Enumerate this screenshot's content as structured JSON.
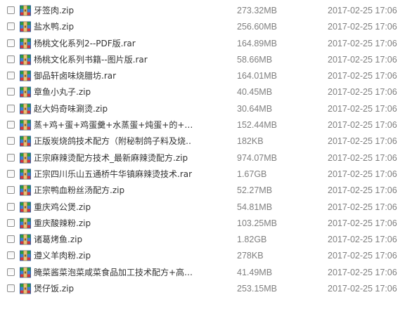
{
  "icon_name": "archive-icon",
  "files": [
    {
      "name": "牙签肉.zip",
      "size": "273.32MB",
      "date": "2017-02-25 17:06"
    },
    {
      "name": "盐水鸭.zip",
      "size": "256.60MB",
      "date": "2017-02-25 17:06"
    },
    {
      "name": "杨桃文化系列2--PDF版.rar",
      "size": "164.89MB",
      "date": "2017-02-25 17:06"
    },
    {
      "name": "杨桃文化系列书籍--图片版.rar",
      "size": "58.66MB",
      "date": "2017-02-25 17:06"
    },
    {
      "name": "御品轩卤味烧腊坊.rar",
      "size": "164.01MB",
      "date": "2017-02-25 17:06"
    },
    {
      "name": "章鱼小丸子.zip",
      "size": "40.45MB",
      "date": "2017-02-25 17:06"
    },
    {
      "name": "赵大妈奇味涮烫.zip",
      "size": "30.64MB",
      "date": "2017-02-25 17:06"
    },
    {
      "name": "蒸+鸡+蛋+鸡蛋羹+水蒸蛋+炖蛋+的+…",
      "size": "152.44MB",
      "date": "2017-02-25 17:06"
    },
    {
      "name": "正版炭烧鸽技术配方（附秘制鸽子料及烧…",
      "size": "182KB",
      "date": "2017-02-25 17:06"
    },
    {
      "name": "正宗麻辣烫配方技术_最新麻辣烫配方.zip",
      "size": "974.07MB",
      "date": "2017-02-25 17:06"
    },
    {
      "name": "正宗四川乐山五通桥牛华镇麻辣烫技术.rar",
      "size": "1.67GB",
      "date": "2017-02-25 17:06"
    },
    {
      "name": "正宗鸭血粉丝汤配方.zip",
      "size": "52.27MB",
      "date": "2017-02-25 17:06"
    },
    {
      "name": "重庆鸡公煲.zip",
      "size": "54.81MB",
      "date": "2017-02-25 17:06"
    },
    {
      "name": "重庆酸辣粉.zip",
      "size": "103.25MB",
      "date": "2017-02-25 17:06"
    },
    {
      "name": "诸葛烤鱼.zip",
      "size": "1.82GB",
      "date": "2017-02-25 17:06"
    },
    {
      "name": "遵义羊肉粉.zip",
      "size": "278KB",
      "date": "2017-02-25 17:06"
    },
    {
      "name": "腌菜酱菜泡菜咸菜食品加工技术配方+高…",
      "size": "41.49MB",
      "date": "2017-02-25 17:06"
    },
    {
      "name": "煲仔饭.zip",
      "size": "253.15MB",
      "date": "2017-02-25 17:06"
    }
  ]
}
